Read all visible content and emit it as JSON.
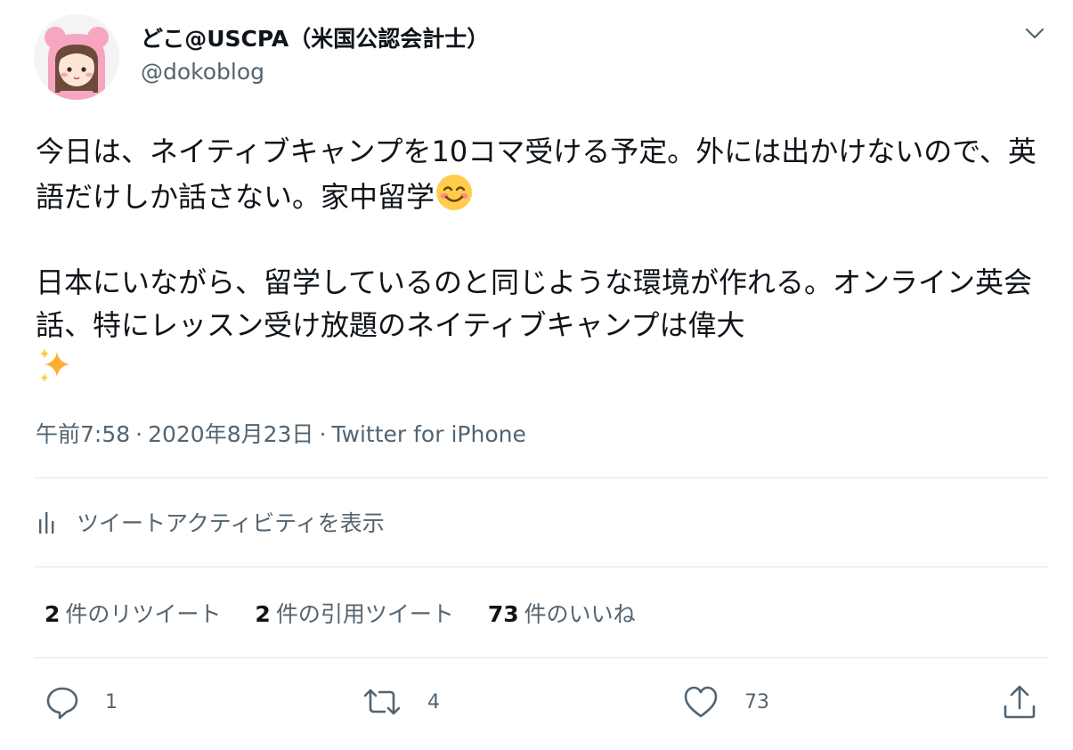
{
  "author": {
    "display_name": "どこ@USCPA（米国公認会計士）",
    "handle": "@dokoblog"
  },
  "tweet": {
    "line1": "今日は、ネイティブキャンプを10コマ受ける予定。外には出かけないので、英語だけしか話さない。家中留学",
    "line2": "日本にいながら、留学しているのと同じような環境が作れる。オンライン英会話、特にレッスン受け放題のネイティブキャンプは偉大",
    "emoji1": "smiling-face-emoji",
    "emoji2": "sparkles-emoji"
  },
  "meta": {
    "time": "午前7:58",
    "dot": "·",
    "date": "2020年8月23日",
    "source": "Twitter for iPhone"
  },
  "activity": {
    "label": "ツイートアクティビティを表示",
    "icon": "bar-chart-icon"
  },
  "stats": {
    "retweets_count": "2",
    "retweets_label": "件のリツイート",
    "quotes_count": "2",
    "quotes_label": "件の引用ツイート",
    "likes_count": "73",
    "likes_label": "件のいいね"
  },
  "actions": {
    "reply_count": "1",
    "retweet_count": "4",
    "like_count": "73",
    "icons": [
      "reply-icon",
      "retweet-icon",
      "heart-icon",
      "share-icon"
    ]
  },
  "colors": {
    "text_primary": "#0f1419",
    "text_secondary": "#536471",
    "divider": "#e1e6ea"
  }
}
